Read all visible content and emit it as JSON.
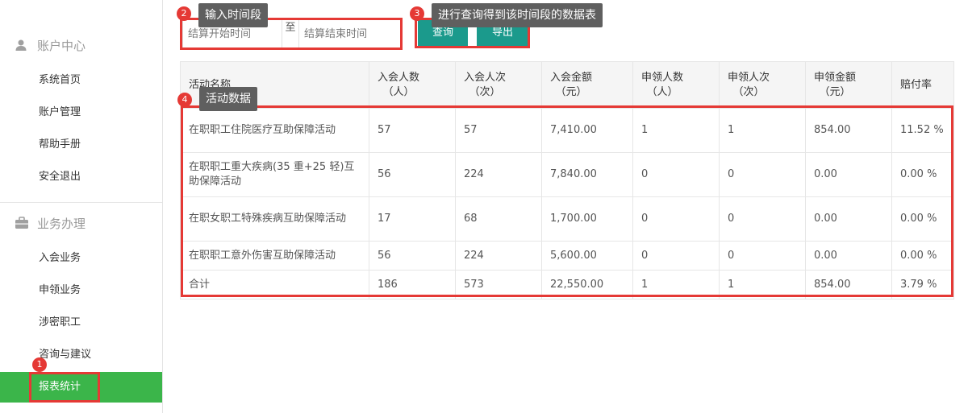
{
  "sidebar": {
    "groups": [
      {
        "title": "账户中心",
        "icon": "user-icon"
      },
      {
        "title": "业务办理",
        "icon": "briefcase-icon"
      }
    ],
    "account_items": [
      "系统首页",
      "账户管理",
      "帮助手册",
      "安全退出"
    ],
    "business_items": [
      "入会业务",
      "申领业务",
      "涉密职工",
      "咨询与建议"
    ],
    "active_item": "报表统计",
    "active_color": "#3bb54a"
  },
  "filter": {
    "start_placeholder": "结算开始时间",
    "separator": "至",
    "end_placeholder": "结算结束时间",
    "query_label": "查询",
    "export_label": "导出",
    "button_color": "#1b9a8c"
  },
  "table": {
    "headers": [
      {
        "l1": "活动名称",
        "l2": ""
      },
      {
        "l1": "入会人数",
        "l2": "（人）"
      },
      {
        "l1": "入会人次",
        "l2": "（次）"
      },
      {
        "l1": "入会金额",
        "l2": "（元）"
      },
      {
        "l1": "申领人数",
        "l2": "（人）"
      },
      {
        "l1": "申领人次",
        "l2": "（次）"
      },
      {
        "l1": "申领金额",
        "l2": "（元）"
      },
      {
        "l1": "赔付率",
        "l2": ""
      }
    ],
    "rows": [
      [
        "在职职工住院医疗互助保障活动",
        "57",
        "57",
        "7,410.00",
        "1",
        "1",
        "854.00",
        "11.52 %"
      ],
      [
        "在职职工重大疾病(35 重+25 轻)互助保障活动",
        "56",
        "224",
        "7,840.00",
        "0",
        "0",
        "0.00",
        "0.00 %"
      ],
      [
        "在职女职工特殊疾病互助保障活动",
        "17",
        "68",
        "1,700.00",
        "0",
        "0",
        "0.00",
        "0.00 %"
      ],
      [
        "在职职工意外伤害互助保障活动",
        "56",
        "224",
        "5,600.00",
        "0",
        "0",
        "0.00",
        "0.00 %"
      ],
      [
        "合计",
        "186",
        "573",
        "22,550.00",
        "1",
        "1",
        "854.00",
        "3.79 %"
      ]
    ]
  },
  "annotations": [
    {
      "num": "1",
      "text": ""
    },
    {
      "num": "2",
      "text": "输入时间段"
    },
    {
      "num": "3",
      "text": "进行查询得到该时间段的数据表"
    },
    {
      "num": "4",
      "text": "活动数据"
    }
  ],
  "annotation_color": "#e53935"
}
